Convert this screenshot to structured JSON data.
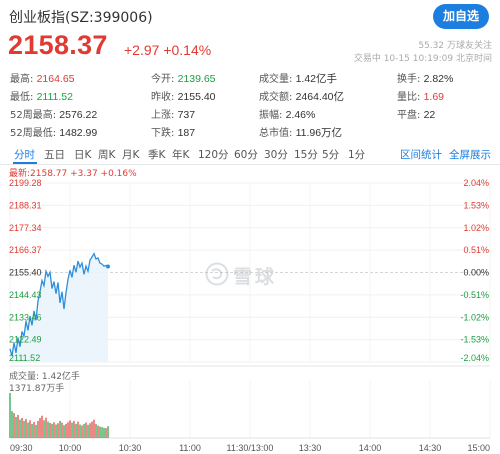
{
  "header": {
    "title": "创业板指(SZ:399006)",
    "follow_label": "加自选",
    "followers": "55.32 万球友关注",
    "trade_status": "交易中 10-15 10:19:09 北京时间"
  },
  "quote": {
    "price": "2158.37",
    "change": "+2.97 +0.14%"
  },
  "stats": [
    {
      "label": "最高:",
      "value": "2164.65",
      "tone": "red"
    },
    {
      "label": "今开:",
      "value": "2139.65",
      "tone": "green"
    },
    {
      "label": "成交量:",
      "value": "1.42亿手",
      "tone": "normal"
    },
    {
      "label": "换手:",
      "value": "2.82%",
      "tone": "normal"
    },
    {
      "label": "最低:",
      "value": "2111.52",
      "tone": "green"
    },
    {
      "label": "昨收:",
      "value": "2155.40",
      "tone": "normal"
    },
    {
      "label": "成交额:",
      "value": "2464.40亿",
      "tone": "normal"
    },
    {
      "label": "量比:",
      "value": "1.69",
      "tone": "red"
    },
    {
      "label": "52周最高:",
      "value": "2576.22",
      "tone": "normal"
    },
    {
      "label": "上涨:",
      "value": "737",
      "tone": "normal"
    },
    {
      "label": "振幅:",
      "value": "2.46%",
      "tone": "normal"
    },
    {
      "label": "平盘:",
      "value": "22",
      "tone": "normal"
    },
    {
      "label": "52周最低:",
      "value": "1482.99",
      "tone": "normal"
    },
    {
      "label": "下跌:",
      "value": "187",
      "tone": "normal"
    },
    {
      "label": "总市值:",
      "value": "11.96万亿",
      "tone": "normal"
    }
  ],
  "tabs": [
    "分时",
    "五日",
    "日K",
    "周K",
    "月K",
    "季K",
    "年K",
    "120分",
    "60分",
    "30分",
    "15分",
    "5分",
    "1分"
  ],
  "tab_links": [
    "区间统计",
    "全屏展示"
  ],
  "legend": "最新:2158.77 +3.37 +0.16%",
  "volume": {
    "label": "成交量: 1.42亿手",
    "max_label": "1371.87万手"
  },
  "watermark": "雪球",
  "colors": {
    "accent": "#1c7fe0",
    "up": "#e03b33",
    "down": "#1e9e43",
    "line": "#2f8fdb"
  },
  "chart_data": {
    "type": "line",
    "title": "",
    "y_left_ticks": [
      "2199.28",
      "2188.31",
      "2177.34",
      "2166.37",
      "2155.40",
      "2144.43",
      "2133.46",
      "2122.49",
      "2111.52"
    ],
    "y_right_ticks": [
      "2.04%",
      "1.53%",
      "1.02%",
      "0.51%",
      "0.00%",
      "-0.51%",
      "-1.02%",
      "-1.53%",
      "-2.04%"
    ],
    "ylim": [
      2111.52,
      2199.28
    ],
    "baseline": 2155.4,
    "x_ticks": [
      "09:30",
      "10:00",
      "10:30",
      "11:00",
      "11:30/13:00",
      "13:30",
      "14:00",
      "14:30",
      "15:00"
    ],
    "total_minutes": 240,
    "series": [
      {
        "minutes": [
          0,
          1,
          2,
          3,
          4,
          5,
          6,
          7,
          8,
          9,
          10,
          11,
          12,
          13,
          14,
          15,
          16,
          17,
          18,
          19,
          20,
          21,
          22,
          23,
          24,
          25,
          26,
          27,
          28,
          29,
          30,
          31,
          32,
          33,
          34,
          35,
          36,
          37,
          38,
          39,
          40,
          41,
          42,
          43,
          44,
          45,
          46,
          47,
          48,
          49
        ],
        "values": [
          2118.0,
          2114.5,
          2121.0,
          2116.0,
          2123.5,
          2119.0,
          2126.5,
          2124.0,
          2131.5,
          2127.0,
          2134.0,
          2129.5,
          2136.5,
          2132.0,
          2141.5,
          2146.0,
          2151.5,
          2149.0,
          2156.0,
          2153.5,
          2155.5,
          2147.5,
          2151.0,
          2145.0,
          2150.5,
          2140.5,
          2146.0,
          2137.5,
          2145.5,
          2152.0,
          2156.5,
          2153.0,
          2159.0,
          2155.5,
          2161.0,
          2158.0,
          2160.0,
          2154.5,
          2158.5,
          2156.0,
          2161.5,
          2163.0,
          2164.65,
          2162.0,
          2162.5,
          2160.0,
          2159.5,
          2158.5,
          2158.77,
          2158.37
        ]
      }
    ],
    "volume_max": 1371.87,
    "volume_unit": "万手",
    "volumes": [
      1371.87,
      820,
      760,
      640,
      700,
      560,
      610,
      520,
      580,
      470,
      540,
      430,
      490,
      400,
      520,
      610,
      680,
      540,
      620,
      500,
      460,
      430,
      480,
      410,
      450,
      520,
      470,
      390,
      430,
      480,
      540,
      470,
      520,
      430,
      500,
      410,
      380,
      430,
      470,
      400,
      450,
      500,
      560,
      430,
      380,
      350,
      330,
      310,
      300,
      360
    ]
  }
}
